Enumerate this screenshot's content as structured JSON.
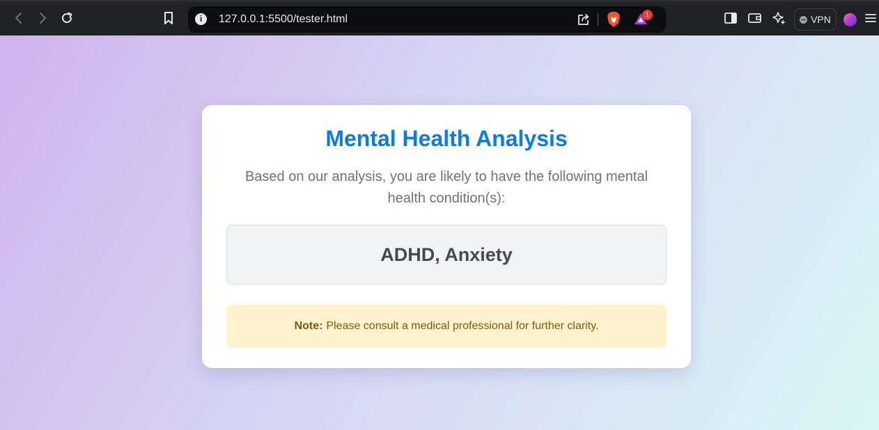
{
  "browser": {
    "url": "127.0.0.1:5500/tester.html",
    "vpn_label": "VPN",
    "rewards_badge": "1",
    "info_glyph": "i"
  },
  "page": {
    "title": "Mental Health Analysis",
    "subtitle": "Based on our analysis, you are likely to have the following mental health condition(s):",
    "result": "ADHD, Anxiety",
    "note_label": "Note:",
    "note_text": "Please consult a medical professional for further clarity."
  },
  "colors": {
    "title_blue": "#0b7ce0",
    "note_background": "#fff2cc",
    "result_background": "#f1f3f5"
  },
  "icons": [
    "back-icon",
    "forward-icon",
    "reload-icon",
    "bookmark-icon",
    "site-info-icon",
    "share-icon",
    "brave-shields-icon",
    "brave-rewards-icon",
    "sidebar-icon",
    "wallet-icon",
    "leo-ai-icon",
    "vpn-icon",
    "profile-avatar",
    "menu-icon"
  ]
}
